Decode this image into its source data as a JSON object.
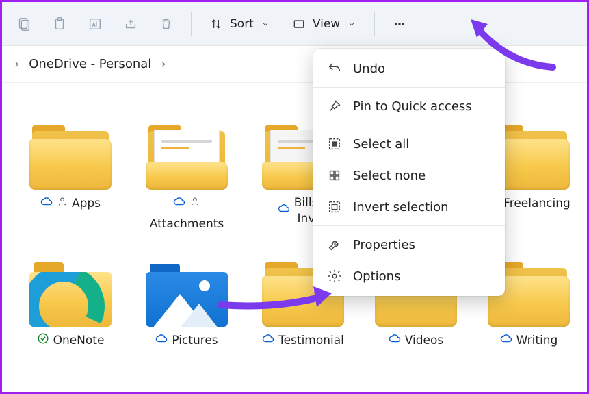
{
  "toolbar": {
    "sort_label": "Sort",
    "view_label": "View"
  },
  "breadcrumb": {
    "current": "OneDrive - Personal"
  },
  "items": [
    {
      "name": "Apps",
      "status": "cloud",
      "shared": true,
      "type": "folder"
    },
    {
      "name": "Attachments",
      "status": "cloud",
      "shared": true,
      "type": "folder-doc"
    },
    {
      "name": "Bills and Invoices",
      "status": "cloud",
      "shared": false,
      "type": "folder-doc",
      "truncated": "Bills a\nInvoi"
    },
    {
      "name": "Freelancing",
      "status": "cloud",
      "shared": false,
      "type": "folder"
    },
    {
      "name": "OneNote",
      "status": "synced",
      "shared": false,
      "type": "folder-onenote"
    },
    {
      "name": "Pictures",
      "status": "cloud",
      "shared": false,
      "type": "folder-pictures"
    },
    {
      "name": "Testimonial",
      "status": "cloud",
      "shared": false,
      "type": "folder"
    },
    {
      "name": "Videos",
      "status": "cloud",
      "shared": false,
      "type": "folder"
    },
    {
      "name": "Writing",
      "status": "cloud",
      "shared": false,
      "type": "folder"
    }
  ],
  "menu": {
    "undo": "Undo",
    "pin": "Pin to Quick access",
    "select_all": "Select all",
    "select_none": "Select none",
    "invert": "Invert selection",
    "properties": "Properties",
    "options": "Options"
  }
}
